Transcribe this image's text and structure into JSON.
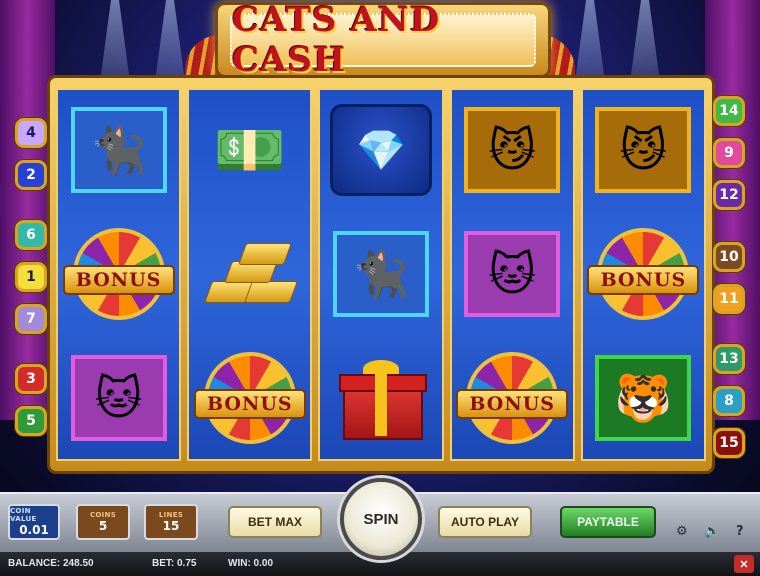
{
  "game": {
    "title": "CATS AND CASH"
  },
  "paylines": {
    "left": [
      {
        "number": "4",
        "color": "#c9a7ff"
      },
      {
        "number": "2",
        "color": "#2840d8"
      },
      {
        "number": "6",
        "color": "#34b8a8"
      },
      {
        "number": "1",
        "color": "#f5df3a"
      },
      {
        "number": "7",
        "color": "#a58ad8"
      },
      {
        "number": "3",
        "color": "#d32a2a"
      },
      {
        "number": "5",
        "color": "#2e9a3a"
      }
    ],
    "right": [
      {
        "number": "14",
        "color": "#3fb845"
      },
      {
        "number": "9",
        "color": "#e04b9f"
      },
      {
        "number": "12",
        "color": "#6a2aa8"
      },
      {
        "number": "10",
        "color": "#7a4b23"
      },
      {
        "number": "11",
        "color": "#f0a020"
      },
      {
        "number": "13",
        "color": "#2e9a6a"
      },
      {
        "number": "8",
        "color": "#2aa0c8"
      },
      {
        "number": "15",
        "color": "#8a1010"
      }
    ]
  },
  "reels": [
    [
      "lady-cat",
      "bonus-wheel",
      "pink-cat"
    ],
    [
      "money-stack",
      "gold-bars",
      "bonus-wheel"
    ],
    [
      "diamond-necklace",
      "lady-cat",
      "gift-box"
    ],
    [
      "gangster-cat",
      "pink-cat",
      "bonus-wheel"
    ],
    [
      "gangster-cat",
      "bonus-wheel",
      "tiger-cat"
    ]
  ],
  "symbols": {
    "bonus_label": "BONUS"
  },
  "controls": {
    "coin_value_label": "COIN VALUE",
    "coin_value": "0.01",
    "coins_label": "COINS",
    "coins": "5",
    "lines_label": "LINES",
    "lines": "15",
    "bet_max": "BET MAX",
    "spin": "SPIN",
    "auto_play": "AUTO PLAY",
    "paytable": "PAYTABLE",
    "help": "?"
  },
  "status": {
    "balance": "BALANCE: 248.50",
    "bet": "BET: 0.75",
    "win": "WIN: 0.00",
    "close": "✕"
  },
  "colors": {
    "coin_value_bg": "#1b3f8a",
    "coins_bg": "#7a4a1e",
    "lines_bg": "#7a4a1e"
  }
}
